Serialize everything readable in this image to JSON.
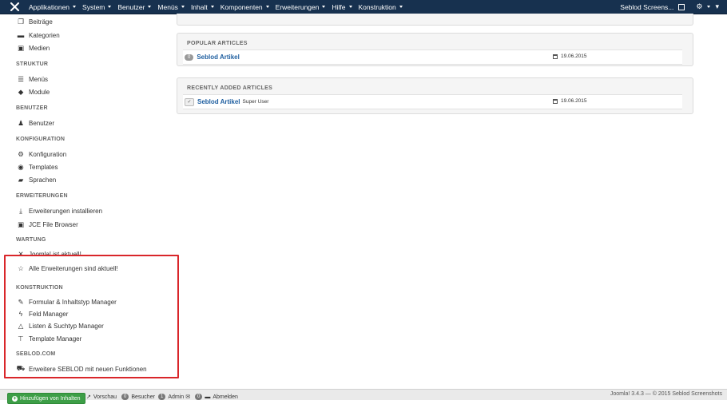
{
  "navbar": {
    "menus": [
      "Applikationen",
      "System",
      "Benutzer",
      "Menüs",
      "Inhalt",
      "Komponenten",
      "Erweiterungen",
      "Hilfe",
      "Konstruktion"
    ],
    "site_name": "Seblod Screens..."
  },
  "sidebar": {
    "items_top": [
      {
        "icon": "copy-icon",
        "label": "Beiträge"
      },
      {
        "icon": "folder-icon",
        "label": "Kategorien"
      },
      {
        "icon": "image-icon",
        "label": "Medien"
      }
    ],
    "struktur": {
      "heading": "STRUKTUR",
      "items": [
        {
          "icon": "list-icon",
          "label": "Menüs"
        },
        {
          "icon": "cube-icon",
          "label": "Module"
        }
      ]
    },
    "benutzer": {
      "heading": "BENUTZER",
      "items": [
        {
          "icon": "users-icon",
          "label": "Benutzer"
        }
      ]
    },
    "konfiguration": {
      "heading": "KONFIGURATION",
      "items": [
        {
          "icon": "cog-icon",
          "label": "Konfiguration"
        },
        {
          "icon": "eye-icon",
          "label": "Templates"
        },
        {
          "icon": "comments-icon",
          "label": "Sprachen"
        }
      ]
    },
    "erweiterungen": {
      "heading": "ERWEITERUNGEN",
      "items": [
        {
          "icon": "download-icon",
          "label": "Erweiterungen installieren"
        },
        {
          "icon": "image-icon",
          "label": "JCE File Browser"
        }
      ]
    },
    "wartung": {
      "heading": "WARTUNG",
      "items": [
        {
          "icon": "joomla-icon",
          "label": "Joomla! ist aktuell!"
        },
        {
          "icon": "star-icon",
          "label": "Alle Erweiterungen sind aktuell!"
        }
      ]
    },
    "konstruktion": {
      "heading": "KONSTRUKTION",
      "items": [
        {
          "icon": "brush-icon",
          "label": "Formular & Inhaltstyp Manager"
        },
        {
          "icon": "bolt-icon",
          "label": "Feld Manager"
        },
        {
          "icon": "flask-icon",
          "label": "Listen & Suchtyp Manager"
        },
        {
          "icon": "hammer-icon",
          "label": "Template Manager"
        }
      ]
    },
    "seblod": {
      "heading": "SEBLOD.COM",
      "items": [
        {
          "icon": "cart-icon",
          "label": "Erweitere SEBLOD mit neuen Funktionen"
        }
      ]
    }
  },
  "popular": {
    "heading": "POPULAR ARTICLES",
    "rows": [
      {
        "badge": "0",
        "title": "Seblod Artikel",
        "date": "19.06.2015"
      }
    ]
  },
  "recent": {
    "heading": "RECENTLY ADDED ARTICLES",
    "rows": [
      {
        "title": "Seblod Artikel",
        "author": "Super User",
        "date": "19.06.2015"
      }
    ]
  },
  "footer": {
    "add_content": "Hinzufügen von Inhalten",
    "preview": "Vorschau",
    "visitors_count": "0",
    "visitors_label": "Besucher",
    "admin_count": "1",
    "admin_label": "Admin",
    "messages_count": "0",
    "logout": "Abmelden",
    "version": "Joomla! 3.4.3 — © 2015 Seblod Screenshots"
  }
}
